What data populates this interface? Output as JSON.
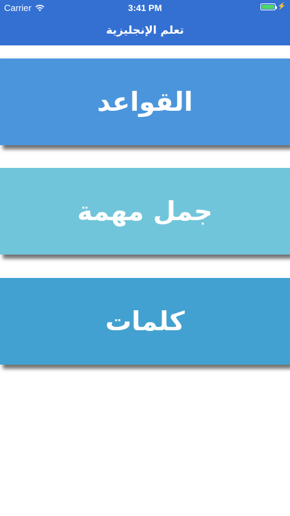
{
  "status_bar": {
    "carrier": "Carrier",
    "time": "3:41 PM",
    "battery_level": 1.0
  },
  "nav": {
    "title": "تعلم الإنجليزية"
  },
  "menu": [
    {
      "label": "القواعد",
      "color": "#4a95dc"
    },
    {
      "label": "جمل مهمة",
      "color": "#71c5da"
    },
    {
      "label": "كلمات",
      "color": "#42a1d0"
    }
  ],
  "colors": {
    "nav_background": "#3470d2",
    "battery_fill": "#4cd964"
  },
  "icons": {
    "wifi": "wifi-icon",
    "battery": "battery-icon",
    "charging": "charging-bolt-icon"
  }
}
